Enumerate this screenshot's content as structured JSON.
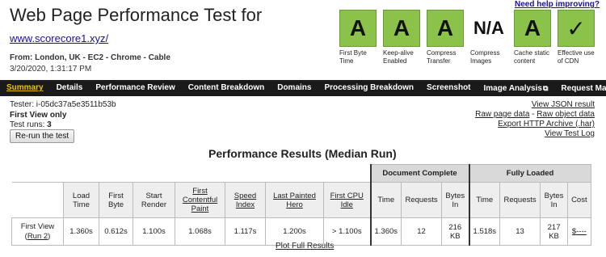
{
  "header": {
    "title": "Web Page Performance Test for",
    "url": "www.scorecore1.xyz/",
    "from": "From: London, UK - EC2 - Chrome - Cable",
    "date": "3/20/2020, 1:31:17 PM",
    "help_link": "Need help improving?"
  },
  "grades": [
    {
      "grade": "A",
      "label": "First Byte Time"
    },
    {
      "grade": "A",
      "label": "Keep-alive Enabled"
    },
    {
      "grade": "A",
      "label": "Compress Transfer"
    },
    {
      "grade": "N/A",
      "label": "Compress Images"
    },
    {
      "grade": "A",
      "label": "Cache static content"
    },
    {
      "grade": "✓",
      "label": "Effective use of CDN"
    }
  ],
  "nav": {
    "items": [
      "Summary",
      "Details",
      "Performance Review",
      "Content Breakdown",
      "Domains",
      "Processing Breakdown",
      "Screenshot",
      "Image Analysis",
      "Request Map"
    ],
    "active": "Summary"
  },
  "info": {
    "tester": "Tester: i-05dc37a5e3511b53b",
    "first_view_only": "First View only",
    "test_runs_label": "Test runs:",
    "test_runs_value": "3",
    "rerun_button": "Re-run the test"
  },
  "links": {
    "view_json": "View JSON result",
    "raw_page": "Raw page data",
    "dash": " - ",
    "raw_object": "Raw object data",
    "export_har": "Export HTTP Archive (.har)",
    "view_log": "View Test Log"
  },
  "results": {
    "title": "Performance Results (Median Run)",
    "group_document": "Document Complete",
    "group_fully": "Fully Loaded",
    "columns": {
      "load_time": "Load Time",
      "first_byte": "First Byte",
      "start_render": "Start Render",
      "fcp": "First Contentful Paint",
      "speed_index": "Speed Index",
      "lph": "Last Painted Hero",
      "first_cpu_idle": "First CPU Idle",
      "time": "Time",
      "requests": "Requests",
      "bytes_in": "Bytes In",
      "cost": "Cost"
    },
    "row": {
      "label": "First View",
      "run_link": "Run 2",
      "load_time": "1.360s",
      "first_byte": "0.612s",
      "start_render": "1.100s",
      "fcp": "1.068s",
      "speed_index": "1.117s",
      "lph": "1.200s",
      "first_cpu_idle": "> 1.100s",
      "doc_time": "1.360s",
      "doc_requests": "12",
      "doc_bytes": "216 KB",
      "full_time": "1.518s",
      "full_requests": "13",
      "full_bytes": "217 KB",
      "cost": "$----"
    },
    "plot_link": "Plot Full Results"
  },
  "colors": {
    "grade_green": "#8bc34a",
    "nav_bg": "#1a1a1a",
    "nav_active": "#f0c000"
  }
}
